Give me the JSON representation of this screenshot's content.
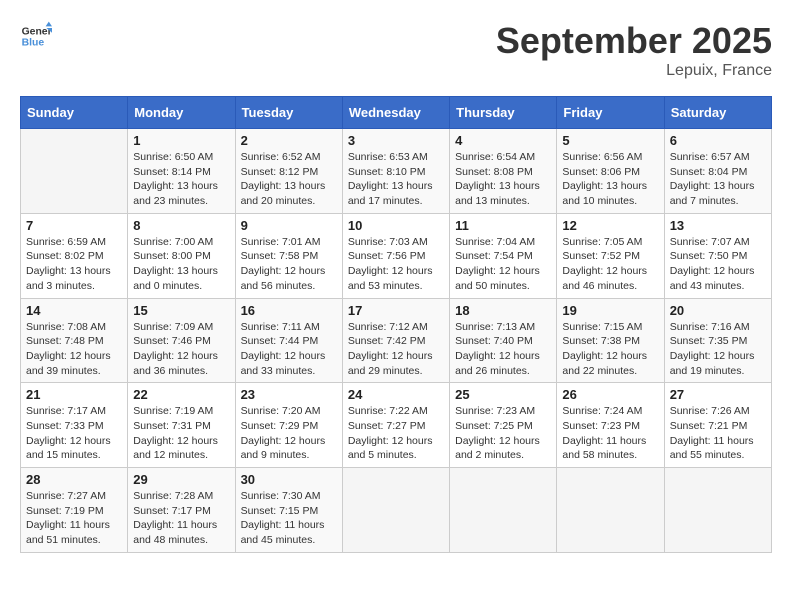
{
  "header": {
    "logo_line1": "General",
    "logo_line2": "Blue",
    "month": "September 2025",
    "location": "Lepuix, France"
  },
  "days_of_week": [
    "Sunday",
    "Monday",
    "Tuesday",
    "Wednesday",
    "Thursday",
    "Friday",
    "Saturday"
  ],
  "weeks": [
    [
      {
        "day": "",
        "info": ""
      },
      {
        "day": "1",
        "info": "Sunrise: 6:50 AM\nSunset: 8:14 PM\nDaylight: 13 hours\nand 23 minutes."
      },
      {
        "day": "2",
        "info": "Sunrise: 6:52 AM\nSunset: 8:12 PM\nDaylight: 13 hours\nand 20 minutes."
      },
      {
        "day": "3",
        "info": "Sunrise: 6:53 AM\nSunset: 8:10 PM\nDaylight: 13 hours\nand 17 minutes."
      },
      {
        "day": "4",
        "info": "Sunrise: 6:54 AM\nSunset: 8:08 PM\nDaylight: 13 hours\nand 13 minutes."
      },
      {
        "day": "5",
        "info": "Sunrise: 6:56 AM\nSunset: 8:06 PM\nDaylight: 13 hours\nand 10 minutes."
      },
      {
        "day": "6",
        "info": "Sunrise: 6:57 AM\nSunset: 8:04 PM\nDaylight: 13 hours\nand 7 minutes."
      }
    ],
    [
      {
        "day": "7",
        "info": "Sunrise: 6:59 AM\nSunset: 8:02 PM\nDaylight: 13 hours\nand 3 minutes."
      },
      {
        "day": "8",
        "info": "Sunrise: 7:00 AM\nSunset: 8:00 PM\nDaylight: 13 hours\nand 0 minutes."
      },
      {
        "day": "9",
        "info": "Sunrise: 7:01 AM\nSunset: 7:58 PM\nDaylight: 12 hours\nand 56 minutes."
      },
      {
        "day": "10",
        "info": "Sunrise: 7:03 AM\nSunset: 7:56 PM\nDaylight: 12 hours\nand 53 minutes."
      },
      {
        "day": "11",
        "info": "Sunrise: 7:04 AM\nSunset: 7:54 PM\nDaylight: 12 hours\nand 50 minutes."
      },
      {
        "day": "12",
        "info": "Sunrise: 7:05 AM\nSunset: 7:52 PM\nDaylight: 12 hours\nand 46 minutes."
      },
      {
        "day": "13",
        "info": "Sunrise: 7:07 AM\nSunset: 7:50 PM\nDaylight: 12 hours\nand 43 minutes."
      }
    ],
    [
      {
        "day": "14",
        "info": "Sunrise: 7:08 AM\nSunset: 7:48 PM\nDaylight: 12 hours\nand 39 minutes."
      },
      {
        "day": "15",
        "info": "Sunrise: 7:09 AM\nSunset: 7:46 PM\nDaylight: 12 hours\nand 36 minutes."
      },
      {
        "day": "16",
        "info": "Sunrise: 7:11 AM\nSunset: 7:44 PM\nDaylight: 12 hours\nand 33 minutes."
      },
      {
        "day": "17",
        "info": "Sunrise: 7:12 AM\nSunset: 7:42 PM\nDaylight: 12 hours\nand 29 minutes."
      },
      {
        "day": "18",
        "info": "Sunrise: 7:13 AM\nSunset: 7:40 PM\nDaylight: 12 hours\nand 26 minutes."
      },
      {
        "day": "19",
        "info": "Sunrise: 7:15 AM\nSunset: 7:38 PM\nDaylight: 12 hours\nand 22 minutes."
      },
      {
        "day": "20",
        "info": "Sunrise: 7:16 AM\nSunset: 7:35 PM\nDaylight: 12 hours\nand 19 minutes."
      }
    ],
    [
      {
        "day": "21",
        "info": "Sunrise: 7:17 AM\nSunset: 7:33 PM\nDaylight: 12 hours\nand 15 minutes."
      },
      {
        "day": "22",
        "info": "Sunrise: 7:19 AM\nSunset: 7:31 PM\nDaylight: 12 hours\nand 12 minutes."
      },
      {
        "day": "23",
        "info": "Sunrise: 7:20 AM\nSunset: 7:29 PM\nDaylight: 12 hours\nand 9 minutes."
      },
      {
        "day": "24",
        "info": "Sunrise: 7:22 AM\nSunset: 7:27 PM\nDaylight: 12 hours\nand 5 minutes."
      },
      {
        "day": "25",
        "info": "Sunrise: 7:23 AM\nSunset: 7:25 PM\nDaylight: 12 hours\nand 2 minutes."
      },
      {
        "day": "26",
        "info": "Sunrise: 7:24 AM\nSunset: 7:23 PM\nDaylight: 11 hours\nand 58 minutes."
      },
      {
        "day": "27",
        "info": "Sunrise: 7:26 AM\nSunset: 7:21 PM\nDaylight: 11 hours\nand 55 minutes."
      }
    ],
    [
      {
        "day": "28",
        "info": "Sunrise: 7:27 AM\nSunset: 7:19 PM\nDaylight: 11 hours\nand 51 minutes."
      },
      {
        "day": "29",
        "info": "Sunrise: 7:28 AM\nSunset: 7:17 PM\nDaylight: 11 hours\nand 48 minutes."
      },
      {
        "day": "30",
        "info": "Sunrise: 7:30 AM\nSunset: 7:15 PM\nDaylight: 11 hours\nand 45 minutes."
      },
      {
        "day": "",
        "info": ""
      },
      {
        "day": "",
        "info": ""
      },
      {
        "day": "",
        "info": ""
      },
      {
        "day": "",
        "info": ""
      }
    ]
  ]
}
